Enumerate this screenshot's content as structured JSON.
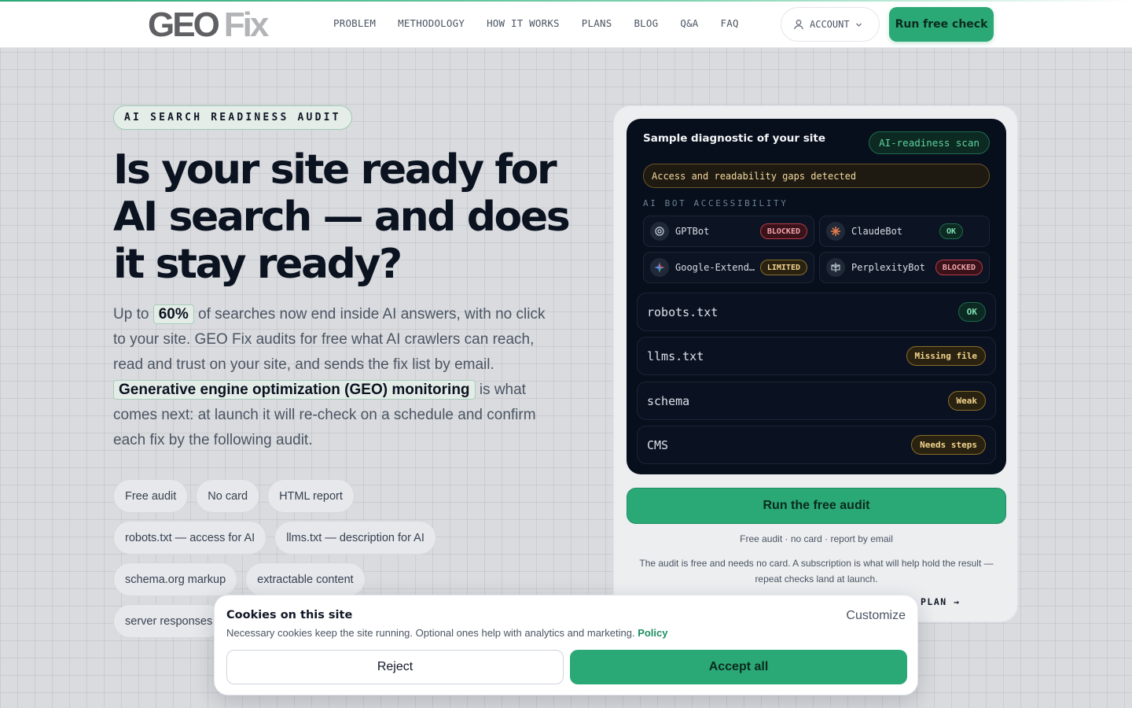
{
  "header": {
    "logo_part1": "GEO",
    "logo_part2": "Fix",
    "nav": [
      "PROBLEM",
      "METHODOLOGY",
      "HOW IT WORKS",
      "PLANS",
      "BLOG",
      "Q&A",
      "FAQ"
    ],
    "account_label": "ACCOUNT",
    "cta_label": "Run free check"
  },
  "hero": {
    "eyebrow": "AI SEARCH READINESS AUDIT",
    "title": "Is your site ready for AI search — and does it stay ready?",
    "lead": {
      "p1": "Up to",
      "stat": "60%",
      "p2": "of searches now end inside AI answers, with no click to your site. GEO Fix audits for free what AI crawlers can reach, read and trust on your site, and sends the fix list by email.",
      "highlight": "Generative engine optimization (GEO) monitoring",
      "p3": "is what comes next: at launch it will re-check on a schedule and confirm each fix by the following audit."
    },
    "chips": [
      [
        "Free audit",
        "No card",
        "HTML report"
      ],
      [
        "robots.txt — access for AI",
        "llms.txt — description for AI"
      ],
      [
        "schema.org markup",
        "extractable content"
      ],
      [
        "server responses"
      ]
    ]
  },
  "diagnostic": {
    "title": "Sample diagnostic of your site",
    "badge": "AI-readiness scan",
    "alert": "Access and readability gaps detected",
    "bots_label": "AI BOT ACCESSIBILITY",
    "bots": [
      {
        "name": "GPTBot",
        "status": "BLOCKED",
        "icon": "openai-icon"
      },
      {
        "name": "ClaudeBot",
        "status": "OK",
        "icon": "claude-icon"
      },
      {
        "name": "Google-Extended",
        "status": "LIMITED",
        "icon": "gemini-icon"
      },
      {
        "name": "PerplexityBot",
        "status": "BLOCKED",
        "icon": "perplexity-icon"
      }
    ],
    "checks": [
      {
        "name": "robots.txt",
        "status": "OK"
      },
      {
        "name": "llms.txt",
        "status": "Missing file"
      },
      {
        "name": "schema",
        "status": "Weak"
      },
      {
        "name": "CMS",
        "status": "Needs steps"
      }
    ],
    "run_label": "Run the free audit",
    "fine_print": "Free audit · no card · report by email",
    "note": "The audit is free and needs no card. A subscription is what will help hold the result — repeat checks land at launch.",
    "plan_link": "PLAN →"
  },
  "cookie": {
    "title": "Cookies on this site",
    "customize": "Customize",
    "text": "Necessary cookies keep the site running. Optional ones help with analytics and marketing.",
    "policy": "Policy",
    "reject": "Reject",
    "accept": "Accept all"
  },
  "colors": {
    "accent": "#2aa876",
    "dark_panel": "#070e1c",
    "blocked": "#b83a46",
    "warning": "#8a6e2a"
  }
}
